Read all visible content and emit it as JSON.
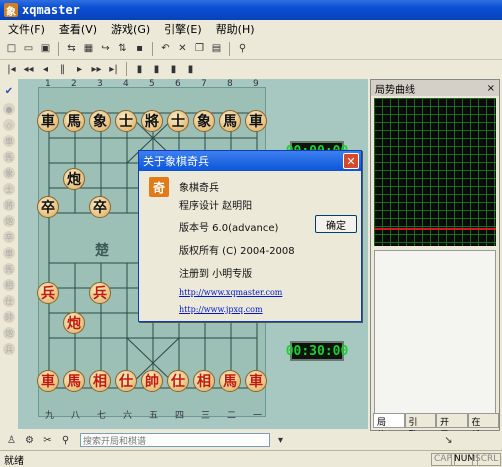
{
  "window": {
    "title": "xqmaster",
    "app_icon": "象"
  },
  "menu": [
    "文件(F)",
    "查看(V)",
    "游戏(G)",
    "引擎(E)",
    "帮助(H)"
  ],
  "board": {
    "files_bottom": [
      "九",
      "八",
      "七",
      "六",
      "五",
      "四",
      "三",
      "二",
      "一"
    ],
    "files_top": [
      "1",
      "2",
      "3",
      "4",
      "5",
      "6",
      "7",
      "8",
      "9"
    ],
    "river": "楚 河",
    "black_back": [
      "車",
      "馬",
      "象",
      "士",
      "將",
      "士",
      "象",
      "馬",
      "車"
    ],
    "black_cannon": "炮",
    "black_pawn": "卒",
    "red_back": [
      "車",
      "馬",
      "相",
      "仕",
      "帥",
      "仕",
      "相",
      "馬",
      "車"
    ],
    "red_cannon": "炮",
    "red_pawn": "兵"
  },
  "clocks": {
    "top": "00:00:00",
    "bottom": "00:30:00"
  },
  "right_panel": {
    "title": "局势曲线",
    "tabs": [
      "局势...",
      "引擎...",
      "开局...",
      "在线..."
    ]
  },
  "dialog": {
    "title": "关于象棋奇兵",
    "icon": "奇",
    "app_name": "象棋奇兵",
    "designer": "程序设计 赵明阳",
    "version": "版本号 6.0(advance)",
    "copyright": "版权所有 (C) 2004-2008",
    "registered": "注册到 小明专版",
    "link1": "http://www.xqmaster.com",
    "link2": "http://www.jpxq.com",
    "ok_label": "确定"
  },
  "bottom": {
    "input_placeholder": "搜索开局和棋谱"
  },
  "status": {
    "text": "就绪",
    "cap": "CAP",
    "num": "NUM",
    "scrl": "SCRL"
  }
}
